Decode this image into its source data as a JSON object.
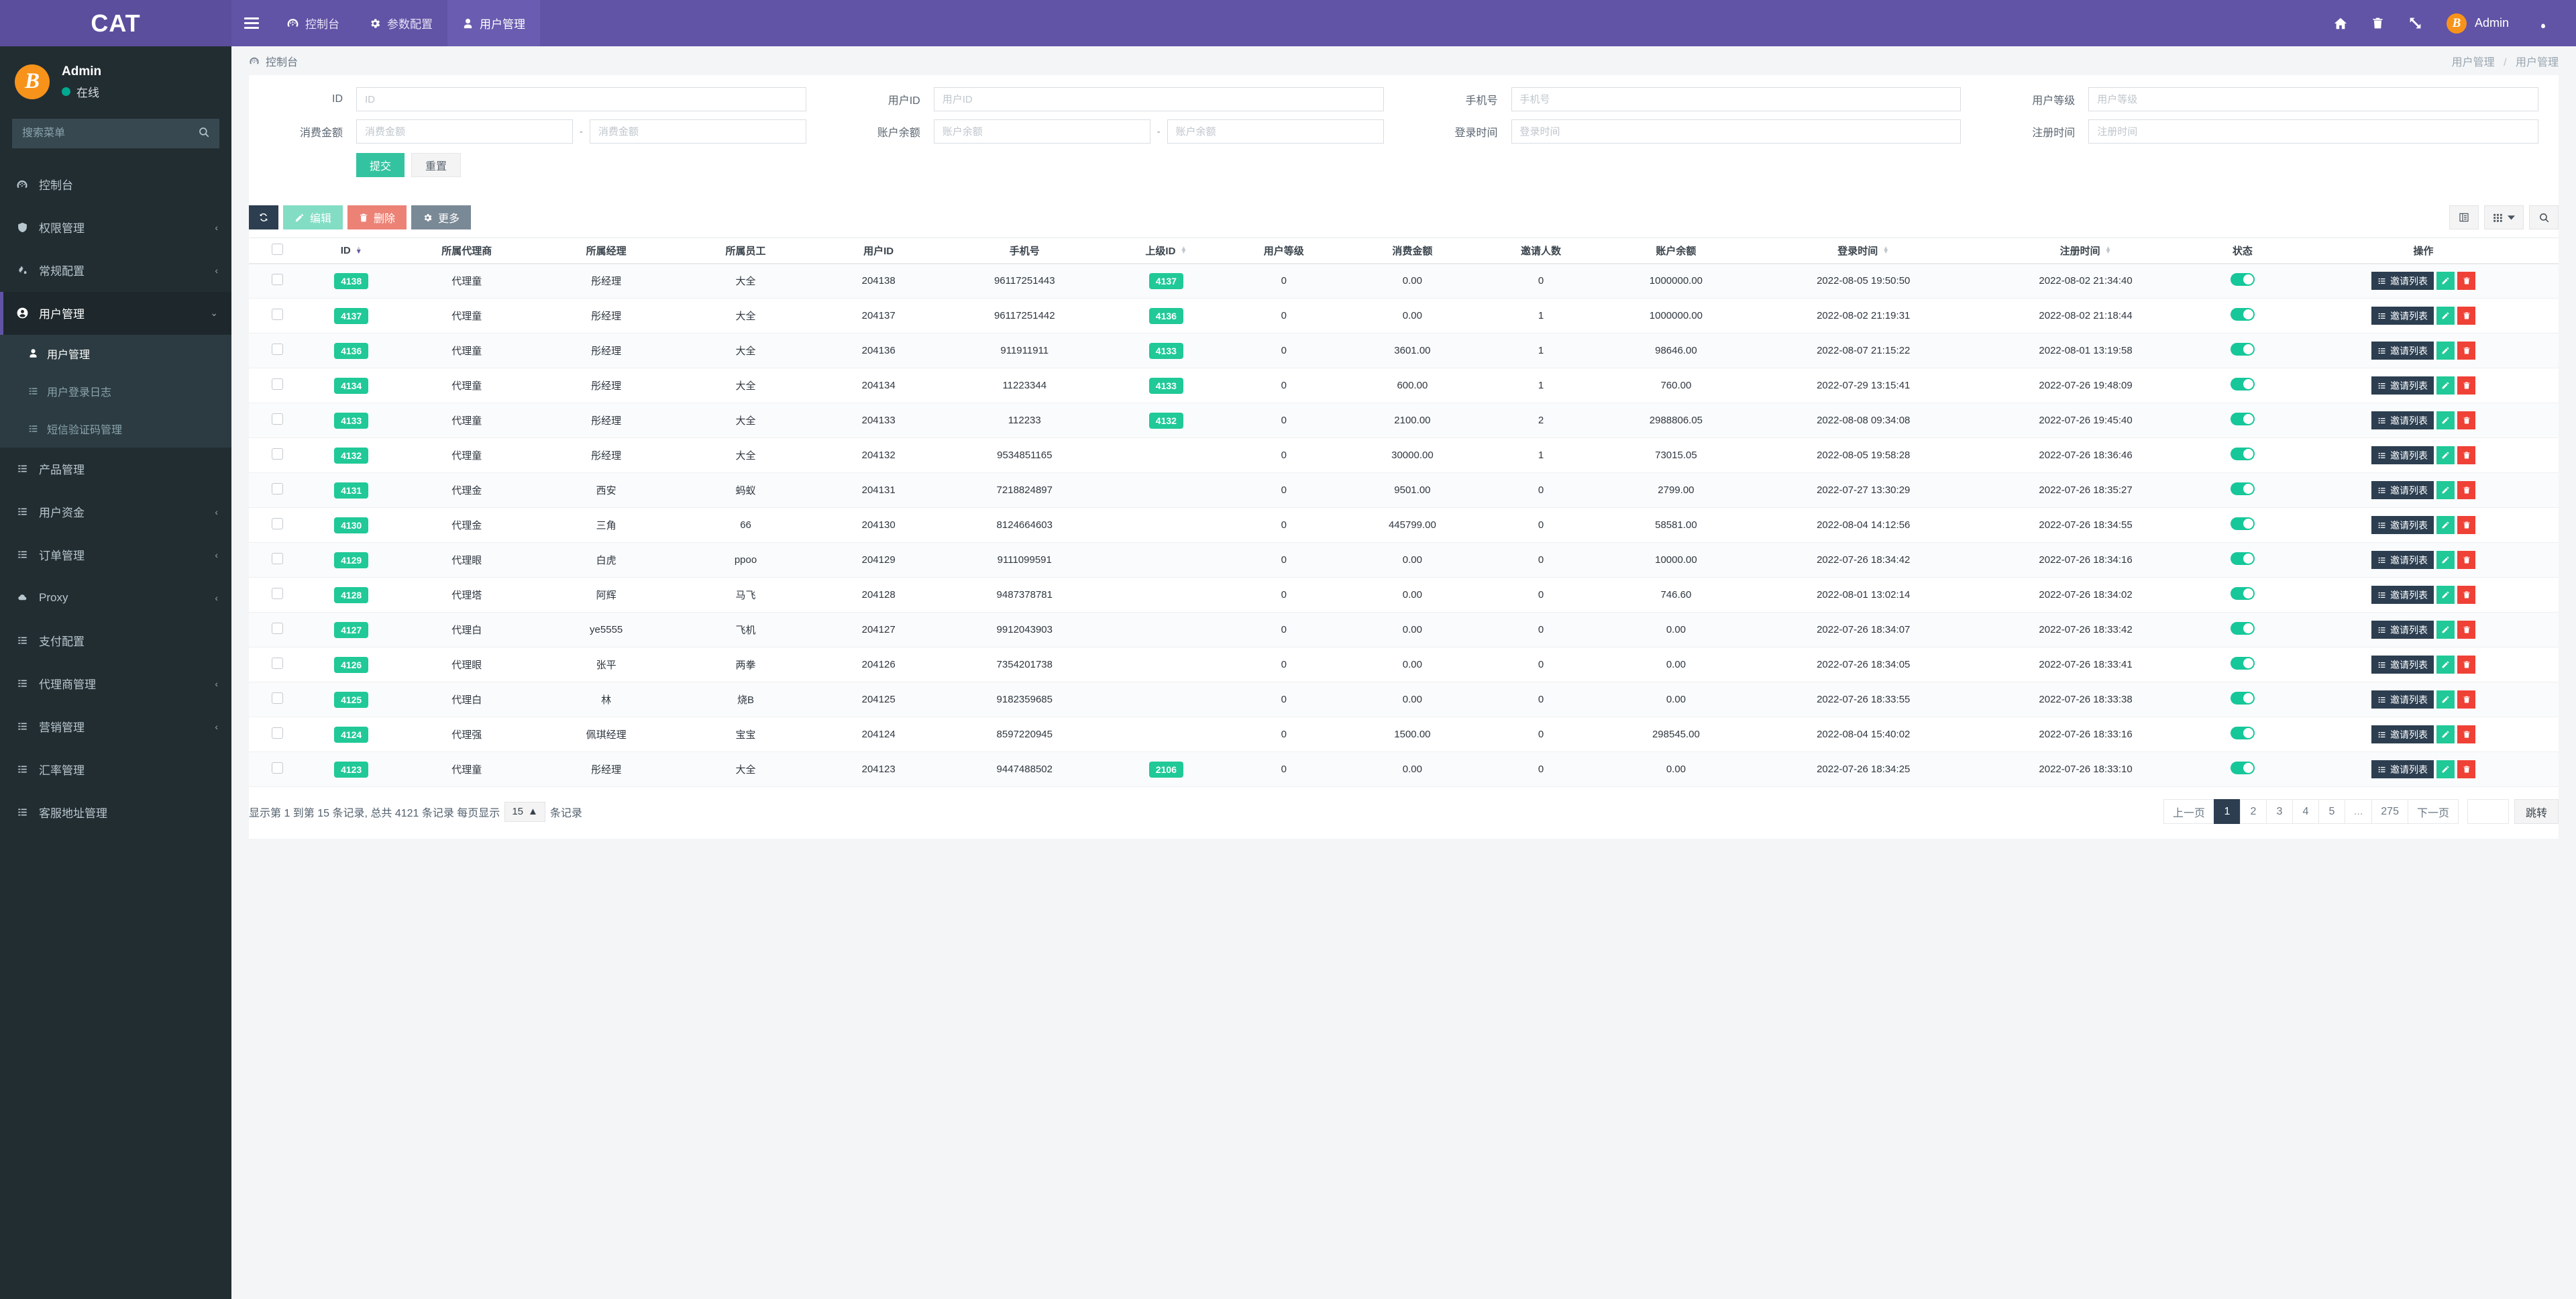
{
  "brand": {
    "title": "CAT"
  },
  "topnav": {
    "burger_icon": "hamburger-menu-icon",
    "tabs": [
      {
        "label": "控制台",
        "icon": "dashboard-icon",
        "active": false
      },
      {
        "label": "参数配置",
        "icon": "gear-icon",
        "active": false
      },
      {
        "label": "用户管理",
        "icon": "user-icon",
        "active": true
      }
    ],
    "right_icons": [
      "home-icon",
      "trash-icon",
      "fullscreen-icon"
    ],
    "user": {
      "name": "Admin",
      "avatar_icon": "bitcoin-icon"
    },
    "settings_icon": "gears-icon"
  },
  "sidebar": {
    "user": {
      "name": "Admin",
      "status": "在线",
      "avatar_icon": "bitcoin-icon"
    },
    "search": {
      "placeholder": "搜索菜单",
      "value": "",
      "icon": "search-icon"
    },
    "items": [
      {
        "label": "控制台",
        "icon": "dashboard-icon",
        "arrow": "",
        "active": false
      },
      {
        "label": "权限管理",
        "icon": "shield-icon",
        "arrow": "‹",
        "active": false
      },
      {
        "label": "常规配置",
        "icon": "gears-icon",
        "arrow": "‹",
        "active": false
      },
      {
        "label": "用户管理",
        "icon": "user-circle-icon",
        "arrow": "⌄",
        "active": true
      },
      {
        "label": "产品管理",
        "icon": "list-icon",
        "arrow": "",
        "active": false
      },
      {
        "label": "用户资金",
        "icon": "list-icon",
        "arrow": "‹",
        "active": false
      },
      {
        "label": "订单管理",
        "icon": "list-icon",
        "arrow": "‹",
        "active": false
      },
      {
        "label": "Proxy",
        "icon": "cloud-icon",
        "arrow": "‹",
        "active": false
      },
      {
        "label": "支付配置",
        "icon": "list-icon",
        "arrow": "",
        "active": false
      },
      {
        "label": "代理商管理",
        "icon": "list-icon",
        "arrow": "‹",
        "active": false
      },
      {
        "label": "营销管理",
        "icon": "list-icon",
        "arrow": "‹",
        "active": false
      },
      {
        "label": "汇率管理",
        "icon": "list-icon",
        "arrow": "",
        "active": false
      },
      {
        "label": "客服地址管理",
        "icon": "list-icon",
        "arrow": "",
        "active": false
      }
    ],
    "submenu": [
      {
        "label": "用户管理",
        "icon": "person-icon",
        "active": true
      },
      {
        "label": "用户登录日志",
        "icon": "list-icon",
        "active": false
      },
      {
        "label": "短信验证码管理",
        "icon": "list-icon",
        "active": false
      }
    ]
  },
  "content_head": {
    "title": "控制台",
    "title_icon": "dashboard-icon",
    "breadcrumb": {
      "parent": "用户管理",
      "sep": "/",
      "current": "用户管理"
    }
  },
  "filters": {
    "fields": [
      {
        "label": "ID",
        "placeholder": "ID",
        "value": "",
        "type": "single"
      },
      {
        "label": "用户ID",
        "placeholder": "用户ID",
        "value": "",
        "type": "single"
      },
      {
        "label": "手机号",
        "placeholder": "手机号",
        "value": "",
        "type": "single"
      },
      {
        "label": "用户等级",
        "placeholder": "用户等级",
        "value": "",
        "type": "single"
      },
      {
        "label": "消费金额",
        "placeholder": "消费金额",
        "placeholder2": "消费金额",
        "value": "",
        "value2": "",
        "type": "range",
        "separator": "-"
      },
      {
        "label": "账户余额",
        "placeholder": "账户余额",
        "placeholder2": "账户余额",
        "value": "",
        "value2": "",
        "type": "range",
        "separator": "-"
      },
      {
        "label": "登录时间",
        "placeholder": "登录时间",
        "value": "",
        "type": "single"
      },
      {
        "label": "注册时间",
        "placeholder": "注册时间",
        "value": "",
        "type": "single"
      }
    ],
    "submit_label": "提交",
    "reset_label": "重置"
  },
  "toolbar": {
    "refresh_icon": "refresh-icon",
    "edit_label": "编辑",
    "edit_icon": "pencil-icon",
    "delete_label": "删除",
    "delete_icon": "trash-icon",
    "more_label": "更多",
    "more_icon": "gear-icon",
    "columns_icon": "columns-icon",
    "grid_icon": "grid-icon",
    "chevron_icon": "chevron-down-icon",
    "search_icon": "search-icon"
  },
  "table": {
    "columns": [
      {
        "key": "check",
        "label": "",
        "sortable": false
      },
      {
        "key": "id",
        "label": "ID",
        "sortable": true,
        "sorted": "desc"
      },
      {
        "key": "agent",
        "label": "所属代理商",
        "sortable": false
      },
      {
        "key": "manager",
        "label": "所属经理",
        "sortable": false
      },
      {
        "key": "staff",
        "label": "所属员工",
        "sortable": false
      },
      {
        "key": "userid",
        "label": "用户ID",
        "sortable": false
      },
      {
        "key": "phone",
        "label": "手机号",
        "sortable": false
      },
      {
        "key": "parentid",
        "label": "上级ID",
        "sortable": true
      },
      {
        "key": "level",
        "label": "用户等级",
        "sortable": false
      },
      {
        "key": "spend",
        "label": "消费金额",
        "sortable": false
      },
      {
        "key": "invites",
        "label": "邀请人数",
        "sortable": false
      },
      {
        "key": "balance",
        "label": "账户余额",
        "sortable": false
      },
      {
        "key": "logintime",
        "label": "登录时间",
        "sortable": true
      },
      {
        "key": "regtime",
        "label": "注册时间",
        "sortable": true
      },
      {
        "key": "status",
        "label": "状态",
        "sortable": false
      },
      {
        "key": "ops",
        "label": "操作",
        "sortable": false
      }
    ],
    "row_ops": {
      "invite_label": "邀请列表",
      "invite_icon": "list-icon",
      "edit_icon": "pencil-icon",
      "delete_icon": "trash-icon",
      "status_on": true
    },
    "rows": [
      {
        "id": "4138",
        "agent": "代理童",
        "manager": "彤经理",
        "staff": "大全",
        "userid": "204138",
        "phone": "96117251443",
        "parentid": "4137",
        "level": "0",
        "spend": "0.00",
        "invites": "0",
        "balance": "1000000.00",
        "logintime": "2022-08-05 19:50:50",
        "regtime": "2022-08-02 21:34:40",
        "status": true
      },
      {
        "id": "4137",
        "agent": "代理童",
        "manager": "彤经理",
        "staff": "大全",
        "userid": "204137",
        "phone": "96117251442",
        "parentid": "4136",
        "level": "0",
        "spend": "0.00",
        "invites": "1",
        "balance": "1000000.00",
        "logintime": "2022-08-02 21:19:31",
        "regtime": "2022-08-02 21:18:44",
        "status": true
      },
      {
        "id": "4136",
        "agent": "代理童",
        "manager": "彤经理",
        "staff": "大全",
        "userid": "204136",
        "phone": "911911911",
        "parentid": "4133",
        "level": "0",
        "spend": "3601.00",
        "invites": "1",
        "balance": "98646.00",
        "logintime": "2022-08-07 21:15:22",
        "regtime": "2022-08-01 13:19:58",
        "status": true
      },
      {
        "id": "4134",
        "agent": "代理童",
        "manager": "彤经理",
        "staff": "大全",
        "userid": "204134",
        "phone": "11223344",
        "parentid": "4133",
        "level": "0",
        "spend": "600.00",
        "invites": "1",
        "balance": "760.00",
        "logintime": "2022-07-29 13:15:41",
        "regtime": "2022-07-26 19:48:09",
        "status": true
      },
      {
        "id": "4133",
        "agent": "代理童",
        "manager": "彤经理",
        "staff": "大全",
        "userid": "204133",
        "phone": "112233",
        "parentid": "4132",
        "level": "0",
        "spend": "2100.00",
        "invites": "2",
        "balance": "2988806.05",
        "logintime": "2022-08-08 09:34:08",
        "regtime": "2022-07-26 19:45:40",
        "status": true
      },
      {
        "id": "4132",
        "agent": "代理童",
        "manager": "彤经理",
        "staff": "大全",
        "userid": "204132",
        "phone": "9534851165",
        "parentid": "",
        "level": "0",
        "spend": "30000.00",
        "invites": "1",
        "balance": "73015.05",
        "logintime": "2022-08-05 19:58:28",
        "regtime": "2022-07-26 18:36:46",
        "status": true
      },
      {
        "id": "4131",
        "agent": "代理金",
        "manager": "西安",
        "staff": "蚂蚁",
        "userid": "204131",
        "phone": "7218824897",
        "parentid": "",
        "level": "0",
        "spend": "9501.00",
        "invites": "0",
        "balance": "2799.00",
        "logintime": "2022-07-27 13:30:29",
        "regtime": "2022-07-26 18:35:27",
        "status": true
      },
      {
        "id": "4130",
        "agent": "代理金",
        "manager": "三角",
        "staff": "66",
        "userid": "204130",
        "phone": "8124664603",
        "parentid": "",
        "level": "0",
        "spend": "445799.00",
        "invites": "0",
        "balance": "58581.00",
        "logintime": "2022-08-04 14:12:56",
        "regtime": "2022-07-26 18:34:55",
        "status": true
      },
      {
        "id": "4129",
        "agent": "代理眼",
        "manager": "白虎",
        "staff": "ppoo",
        "userid": "204129",
        "phone": "9111099591",
        "parentid": "",
        "level": "0",
        "spend": "0.00",
        "invites": "0",
        "balance": "10000.00",
        "logintime": "2022-07-26 18:34:42",
        "regtime": "2022-07-26 18:34:16",
        "status": true
      },
      {
        "id": "4128",
        "agent": "代理塔",
        "manager": "阿辉",
        "staff": "马飞",
        "userid": "204128",
        "phone": "9487378781",
        "parentid": "",
        "level": "0",
        "spend": "0.00",
        "invites": "0",
        "balance": "746.60",
        "logintime": "2022-08-01 13:02:14",
        "regtime": "2022-07-26 18:34:02",
        "status": true
      },
      {
        "id": "4127",
        "agent": "代理白",
        "manager": "ye5555",
        "staff": "飞机",
        "userid": "204127",
        "phone": "9912043903",
        "parentid": "",
        "level": "0",
        "spend": "0.00",
        "invites": "0",
        "balance": "0.00",
        "logintime": "2022-07-26 18:34:07",
        "regtime": "2022-07-26 18:33:42",
        "status": true
      },
      {
        "id": "4126",
        "agent": "代理眼",
        "manager": "张平",
        "staff": "两拳",
        "userid": "204126",
        "phone": "7354201738",
        "parentid": "",
        "level": "0",
        "spend": "0.00",
        "invites": "0",
        "balance": "0.00",
        "logintime": "2022-07-26 18:34:05",
        "regtime": "2022-07-26 18:33:41",
        "status": true
      },
      {
        "id": "4125",
        "agent": "代理白",
        "manager": "林",
        "staff": "烧B",
        "userid": "204125",
        "phone": "9182359685",
        "parentid": "",
        "level": "0",
        "spend": "0.00",
        "invites": "0",
        "balance": "0.00",
        "logintime": "2022-07-26 18:33:55",
        "regtime": "2022-07-26 18:33:38",
        "status": true
      },
      {
        "id": "4124",
        "agent": "代理强",
        "manager": "佩琪经理",
        "staff": "宝宝",
        "userid": "204124",
        "phone": "8597220945",
        "parentid": "",
        "level": "0",
        "spend": "1500.00",
        "invites": "0",
        "balance": "298545.00",
        "logintime": "2022-08-04 15:40:02",
        "regtime": "2022-07-26 18:33:16",
        "status": true
      },
      {
        "id": "4123",
        "agent": "代理童",
        "manager": "彤经理",
        "staff": "大全",
        "userid": "204123",
        "phone": "9447488502",
        "parentid": "2106",
        "level": "0",
        "spend": "0.00",
        "invites": "0",
        "balance": "0.00",
        "logintime": "2022-07-26 18:34:25",
        "regtime": "2022-07-26 18:33:10",
        "status": true
      }
    ]
  },
  "footer": {
    "summary_prefix": "显示第 1 到第 15 条记录, 总共 4121 条记录 每页显示",
    "page_size": "15",
    "page_size_arrow": "▲",
    "summary_suffix": "条记录",
    "pagination": {
      "prev": "上一页",
      "next": "下一页",
      "pages": [
        "1",
        "2",
        "3",
        "4",
        "5",
        "...",
        "275"
      ],
      "active": "1",
      "jump_value": "",
      "jump_label": "跳转"
    }
  },
  "colors": {
    "brand_purple": "#6153a5",
    "sidebar_dark": "#222d32",
    "accent_green": "#20c997",
    "danger_red": "#ef4136",
    "dark_slate": "#2c3e50",
    "bitcoin_orange": "#f7931a"
  }
}
